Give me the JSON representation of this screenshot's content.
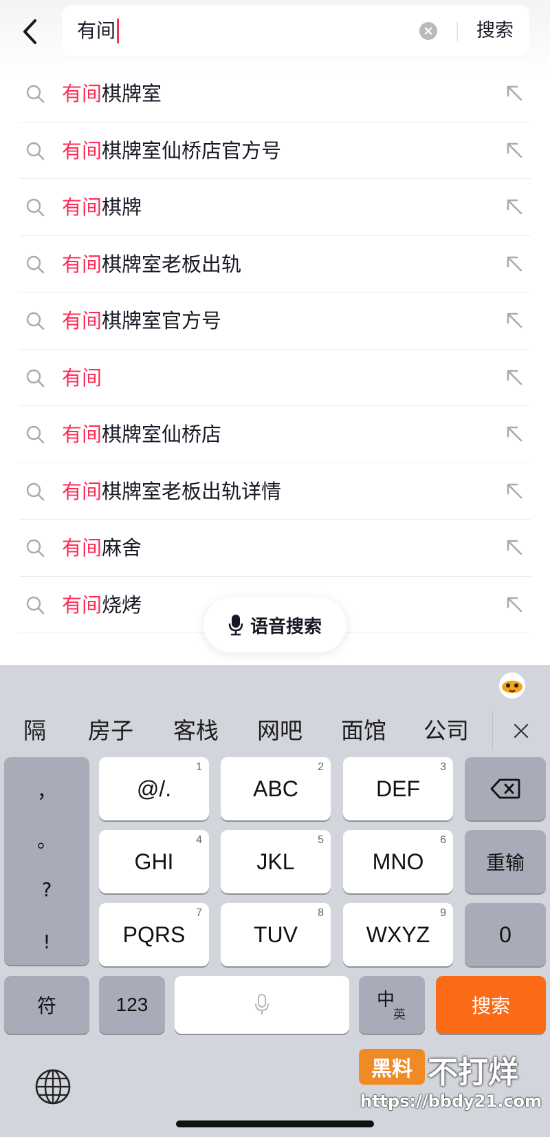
{
  "search": {
    "query": "有间",
    "submit_label": "搜索"
  },
  "suggestions": [
    {
      "highlight": "有间",
      "rest": "棋牌室"
    },
    {
      "highlight": "有间",
      "rest": "棋牌室仙桥店官方号"
    },
    {
      "highlight": "有间",
      "rest": "棋牌"
    },
    {
      "highlight": "有间",
      "rest": "棋牌室老板出轨"
    },
    {
      "highlight": "有间",
      "rest": "棋牌室官方号"
    },
    {
      "highlight": "有间",
      "rest": ""
    },
    {
      "highlight": "有间",
      "rest": "棋牌室仙桥店"
    },
    {
      "highlight": "有间",
      "rest": "棋牌室老板出轨详情"
    },
    {
      "highlight": "有间",
      "rest": "麻舍"
    },
    {
      "highlight": "有间",
      "rest": "烧烤"
    }
  ],
  "voice_search": {
    "label": "语音搜索"
  },
  "keyboard": {
    "candidates": [
      "隔",
      "房子",
      "客栈",
      "网吧",
      "面馆",
      "公司"
    ],
    "punctuation": [
      "，",
      "。",
      "?",
      "!"
    ],
    "keys": {
      "k1": {
        "label": "@/.",
        "num": "1"
      },
      "k2": {
        "label": "ABC",
        "num": "2"
      },
      "k3": {
        "label": "DEF",
        "num": "3"
      },
      "k4": {
        "label": "GHI",
        "num": "4"
      },
      "k5": {
        "label": "JKL",
        "num": "5"
      },
      "k6": {
        "label": "MNO",
        "num": "6"
      },
      "k7": {
        "label": "PQRS",
        "num": "7"
      },
      "k8": {
        "label": "TUV",
        "num": "8"
      },
      "k9": {
        "label": "WXYZ",
        "num": "9"
      },
      "retype": "重输",
      "zero": "0",
      "symbol": "符",
      "numeric": "123",
      "lang_main": "中",
      "lang_sub": "英",
      "search": "搜索"
    }
  },
  "watermark": {
    "logo": "黑料",
    "title": "不打烊",
    "url": "https://bbdy21.com"
  },
  "colors": {
    "highlight": "#fe2c55",
    "search_key": "#fa6a17",
    "keyboard_bg": "#d3d5dc"
  }
}
